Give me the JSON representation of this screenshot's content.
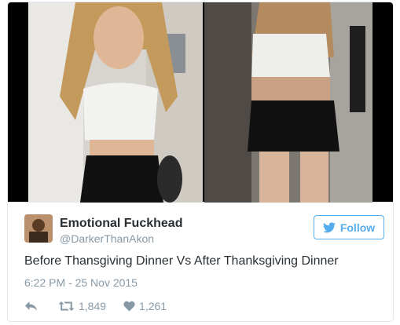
{
  "tweet": {
    "display_name": "Emotional Fuckhead",
    "handle": "@DarkerThanAkon",
    "text": "Before Thansgiving Dinner Vs After Thanksgiving Dinner",
    "timestamp": "6:22 PM - 25 Nov 2015",
    "retweets": "1,849",
    "likes": "1,261"
  },
  "follow_button": {
    "label": "Follow"
  },
  "colors": {
    "accent": "#55acee",
    "text": "#292f33",
    "muted": "#8899a6",
    "border": "#e1e8ed"
  },
  "icons": {
    "reply": "reply-icon",
    "retweet": "retweet-icon",
    "like": "heart-icon",
    "follow": "twitter-bird-icon"
  }
}
